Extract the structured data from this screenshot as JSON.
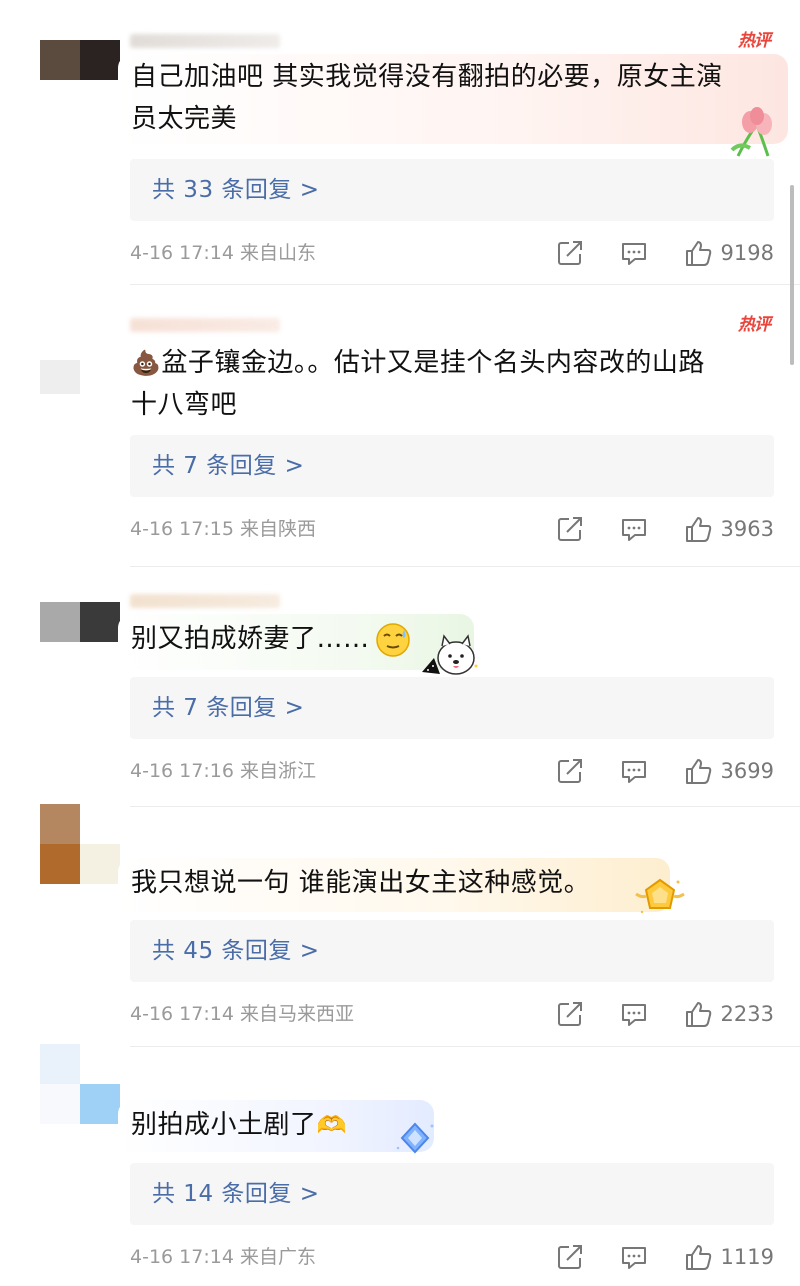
{
  "comments": [
    {
      "text": "自己加油吧 其实我觉得没有翻拍的必要，原女主演员太完美",
      "text_line1": "自己加油吧 其实我觉得没有翻拍的必要，原女主演",
      "text_line2": "员太完美",
      "hot_badge": "热评",
      "reply_label": "共 33 条回复 >",
      "time": "4-16 17:14",
      "location": "来自山东",
      "likes": "9198"
    },
    {
      "text": "盆子镶金边。。估计又是挂个名头内容改的山路十八弯吧",
      "emoji": "💩",
      "text_line1": "盆子镶金边。。估计又是挂个名头内容改的山路",
      "text_line2": "十八弯吧",
      "hot_badge": "热评",
      "reply_label": "共 7 条回复 >",
      "time": "4-16 17:15",
      "location": "来自陕西",
      "likes": "3963"
    },
    {
      "text": "别又拍成娇妻了……",
      "reply_label": "共 7 条回复 >",
      "time": "4-16 17:16",
      "location": "来自浙江",
      "likes": "3699"
    },
    {
      "text": "我只想说一句 谁能演出女主这种感觉。",
      "reply_label": "共 45 条回复 >",
      "time": "4-16 17:14",
      "location": "来自马来西亚",
      "likes": "2233"
    },
    {
      "text": "别拍成小土剧了",
      "emoji": "🫶",
      "reply_label": "共 14 条回复 >",
      "time": "4-16 17:14",
      "location": "来自广东",
      "likes": "1119"
    }
  ],
  "icons": [
    "share-icon",
    "comment-icon",
    "like-icon"
  ],
  "colors": {
    "hot_badge": "#e8453c",
    "reply_link": "#4a6da7",
    "meta_text": "#9a9a9a",
    "reply_bg": "#f6f6f7"
  }
}
